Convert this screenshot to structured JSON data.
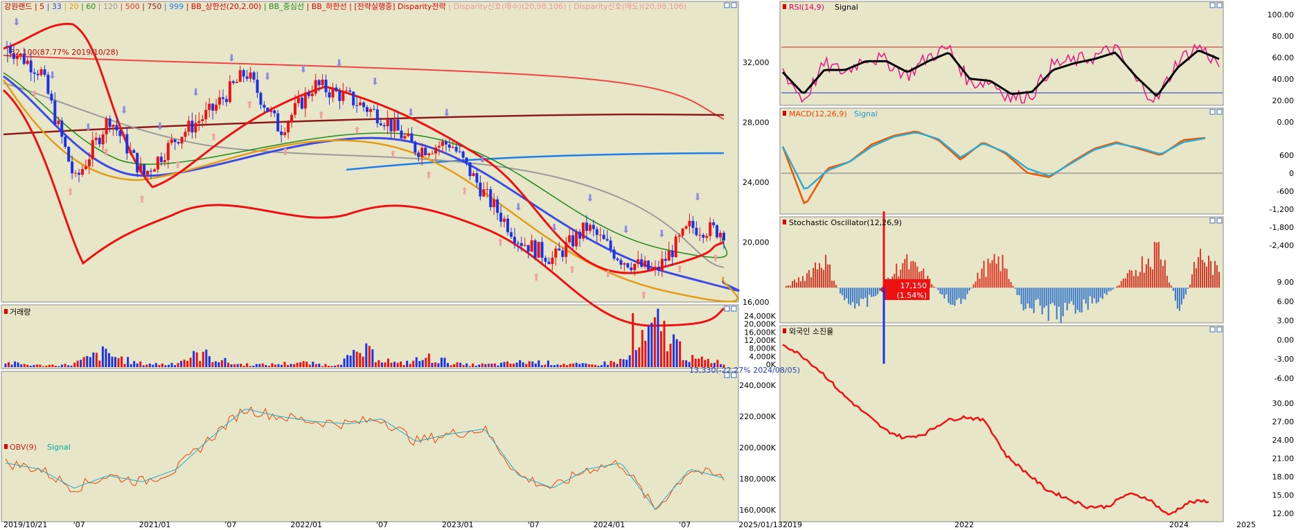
{
  "colors": {
    "panel_bg": "#e8e6c8",
    "red": "#ee1111",
    "blue": "#1c32e6",
    "grid": "#d0cfae"
  },
  "main": {
    "legend": [
      {
        "text": "강원랜드",
        "color": "#cc0000"
      },
      {
        "text": "5",
        "color": "#cc0000"
      },
      {
        "text": "33",
        "color": "#3344ee"
      },
      {
        "text": "20",
        "color": "#e39b1a"
      },
      {
        "text": "60",
        "color": "#1c8a1c"
      },
      {
        "text": "120",
        "color": "#9a9a9a"
      },
      {
        "text": "500",
        "color": "#ee3333"
      },
      {
        "text": "750",
        "color": "#8b1a1a"
      },
      {
        "text": "999",
        "color": "#1f7de8"
      },
      {
        "text": "BB_상한선(20,2.00)",
        "color": "#dd0000"
      },
      {
        "text": "BB_중심선",
        "color": "#1c8a1c"
      },
      {
        "text": "BB_하한선",
        "color": "#dd0000"
      },
      {
        "text": "[전략실행중] Disparity전략",
        "color": "#dd0000"
      },
      {
        "text": "Disparity신호(매수)(20,98,106)",
        "color": "#ee9999"
      },
      {
        "text": "Disparity신호(매도)(20,98,106)",
        "color": "#ee9999"
      }
    ],
    "high_annotation": "32,100(87.77% 2019/10/28)",
    "low_annotation": "13,330(-22.27% 2024/08/05)",
    "price_badge": "17,150",
    "change_badge": "(1.54%)",
    "y_ticks": [
      "32,000",
      "28,000",
      "24,000",
      "20,000",
      "16,000"
    ],
    "x_ticks": [
      "2019/10/21",
      "'07",
      "2021/01",
      "'07",
      "2022/01",
      "'07",
      "2023/01",
      "'07",
      "2024/01",
      "'07",
      "2025/01/13"
    ]
  },
  "volume": {
    "title": "거래량",
    "y_ticks": [
      "24,000K",
      "20,000K",
      "16,000K",
      "12,000K",
      "8,000K",
      "4,000K",
      "0K"
    ]
  },
  "obv": {
    "title": "OBV(9)",
    "signal": "Signal",
    "y_ticks": [
      "240,000K",
      "220,000K",
      "200,000K",
      "180,000K",
      "160,000K"
    ]
  },
  "rsi": {
    "title": "RSI(14,9)",
    "signal": "Signal",
    "y_ticks": [
      "100.00",
      "80.00",
      "60.00",
      "40.00",
      "20.00",
      "0.00"
    ]
  },
  "macd": {
    "title": "MACD(12,26,9)",
    "signal": "Signal",
    "y_ticks": [
      "600",
      "0",
      "-600",
      "-1,200",
      "-1,800",
      "-2,400"
    ]
  },
  "stoch": {
    "title": "Stochastic Oscillator(12,26,9)",
    "y_ticks": [
      "9.00",
      "6.00",
      "3.00",
      "0.00",
      "-3.00",
      "-6.00"
    ]
  },
  "foreign": {
    "title": "외국인 소진율",
    "y_ticks": [
      "30.00",
      "27.00",
      "24.00",
      "21.00",
      "18.00",
      "15.00",
      "12.00"
    ],
    "x_ticks": [
      "2019",
      "2022",
      "2024",
      "2025"
    ]
  },
  "chart_data": [
    {
      "type": "line",
      "title": "강원랜드",
      "ylim": [
        12000,
        34000
      ],
      "x": [
        "2019/10",
        "2020/01",
        "2020/04",
        "2020/07",
        "2020/10",
        "2021/01",
        "2021/04",
        "2021/07",
        "2021/10",
        "2022/01",
        "2022/04",
        "2022/07",
        "2022/10",
        "2023/01",
        "2023/04",
        "2023/07",
        "2023/10",
        "2024/01",
        "2024/04",
        "2024/07",
        "2024/10",
        "2025/01"
      ],
      "series": [
        {
          "name": "close",
          "values": [
            31500,
            29500,
            21000,
            26000,
            21500,
            24500,
            26500,
            29500,
            25000,
            28500,
            27500,
            26000,
            23500,
            24000,
            20000,
            16500,
            15000,
            17500,
            15000,
            14000,
            17500,
            17150
          ]
        }
      ]
    },
    {
      "type": "bar",
      "title": "거래량",
      "ylim": [
        0,
        26000
      ],
      "values": [
        2800,
        1200,
        1600,
        9000,
        2500,
        1800,
        8500,
        2000,
        1500,
        3000,
        1200,
        10000,
        2000,
        6000,
        1500,
        1800,
        3500,
        2200,
        1400,
        4500,
        26000,
        5000,
        3500
      ]
    },
    {
      "type": "line",
      "title": "OBV(9)",
      "ylim": [
        150000,
        260000
      ],
      "series": [
        {
          "name": "OBV",
          "values": [
            195000,
            190000,
            175000,
            185000,
            180000,
            190000,
            215000,
            238000,
            232000,
            228000,
            226000,
            230000,
            212000,
            218000,
            222000,
            185000,
            175000,
            190000,
            195000,
            158000,
            190000,
            183000
          ]
        }
      ]
    },
    {
      "type": "line",
      "title": "RSI(14,9)",
      "ylim": [
        0,
        100
      ],
      "series": [
        {
          "name": "RSI",
          "values": [
            50,
            22,
            55,
            48,
            62,
            58,
            45,
            62,
            70,
            38,
            40,
            24,
            28,
            55,
            58,
            62,
            70,
            40,
            22,
            58,
            72,
            55
          ]
        },
        {
          "name": "Signal",
          "values": [
            48,
            28,
            50,
            50,
            58,
            58,
            48,
            58,
            66,
            42,
            40,
            28,
            30,
            50,
            56,
            60,
            66,
            44,
            26,
            52,
            68,
            60
          ]
        }
      ]
    },
    {
      "type": "line",
      "title": "MACD(12,26,9)",
      "ylim": [
        -2800,
        1000
      ],
      "series": [
        {
          "name": "MACD",
          "values": [
            0,
            -2700,
            -1000,
            -700,
            100,
            500,
            700,
            300,
            -600,
            200,
            -300,
            -1200,
            -1400,
            -700,
            -100,
            200,
            -100,
            -400,
            300,
            400
          ]
        },
        {
          "name": "Signal",
          "values": [
            0,
            -2000,
            -1100,
            -700,
            0,
            450,
            650,
            350,
            -500,
            150,
            -250,
            -1000,
            -1350,
            -750,
            -150,
            150,
            -50,
            -350,
            200,
            380
          ]
        }
      ]
    },
    {
      "type": "bar",
      "title": "Stochastic Oscillator(12,26,9)",
      "ylim": [
        -7,
        12
      ],
      "values": [
        0,
        3,
        8,
        -3,
        -5,
        0,
        7,
        4,
        -2,
        -5,
        5,
        7,
        -4,
        -6,
        -7,
        -5,
        -3,
        1,
        6,
        11,
        -7,
        9,
        4
      ]
    },
    {
      "type": "line",
      "title": "외국인 소진율",
      "ylim": [
        11,
        32
      ],
      "series": [
        {
          "name": "외국인 소진율",
          "values": [
            31.5,
            30,
            28,
            25.5,
            23.5,
            21.5,
            20.5,
            21,
            22.5,
            23,
            22.5,
            18.5,
            16.5,
            14.5,
            13.5,
            12.5,
            12.5,
            14,
            13.5,
            11.5,
            13,
            13.2
          ]
        }
      ]
    }
  ]
}
